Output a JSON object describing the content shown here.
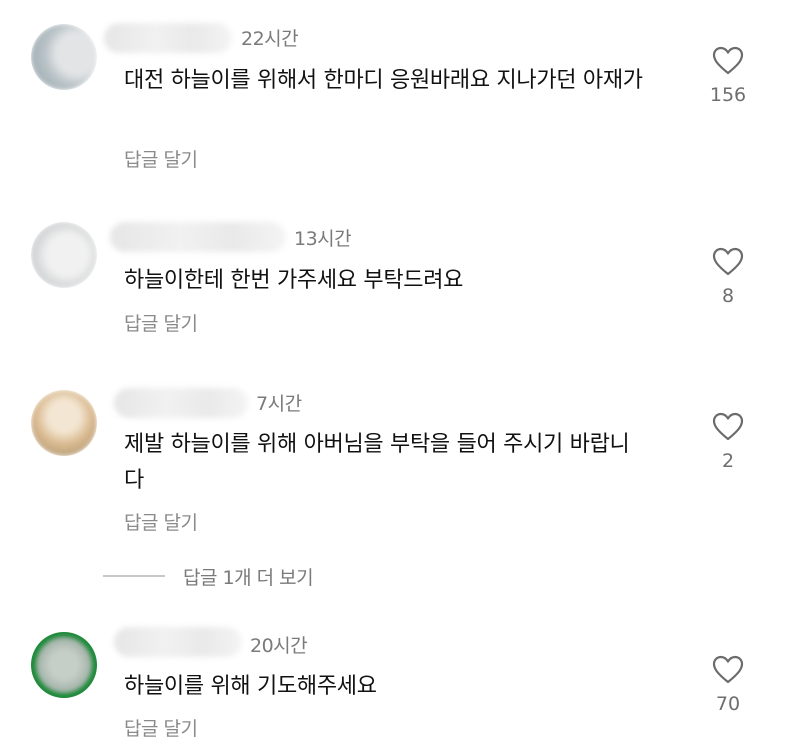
{
  "comments": [
    {
      "time": "22시간",
      "text": "대전 하늘이를 위해서 한마디 응원바래요 지나가던 아재가",
      "reply_label": "답글 달기",
      "likes": "156"
    },
    {
      "time": "13시간",
      "text": "하늘이한테 한번 가주세요 부탁드려요",
      "reply_label": "답글 달기",
      "likes": "8"
    },
    {
      "time": "7시간",
      "text": "제발 하늘이를 위해 아버님을 부탁을 들어 주시기 바랍니다",
      "reply_label": "답글 달기",
      "likes": "2"
    },
    {
      "time": "20시간",
      "text": "하늘이를 위해 기도해주세요",
      "reply_label": "답글 달기",
      "likes": "70"
    }
  ],
  "more_replies_label": "답글 1개 더 보기",
  "colors": {
    "text": "#111111",
    "muted": "#7a7a7a",
    "heart_stroke": "#6b6b6b",
    "avatar4_ring": "#1f8a3a"
  },
  "icons": [
    "heart-outline-icon"
  ]
}
